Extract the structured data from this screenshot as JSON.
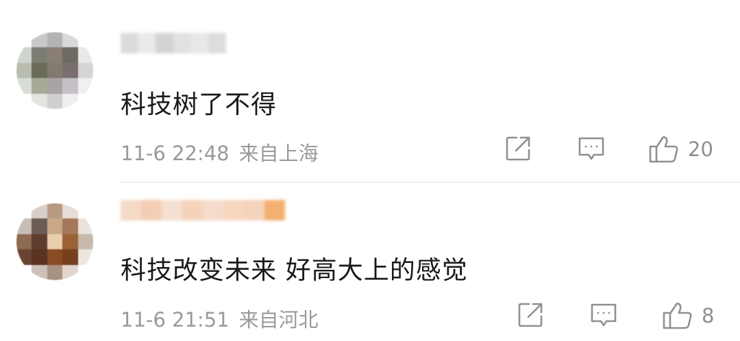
{
  "comments": [
    {
      "text": "科技树了不得",
      "time": "11-6 22:48",
      "location": "来自上海",
      "likes": "20",
      "avatar_colors": [
        "#ffffff",
        "#c9c9c9",
        "#b4b4b4",
        "#d9d9d9",
        "#ffffff",
        "#cfd4cf",
        "#7b7f73",
        "#8a7f74",
        "#6d6a63",
        "#e8e8e8",
        "#b9bdb0",
        "#6a6a5a",
        "#827a70",
        "#7a6f6e",
        "#d5d5d5",
        "#d8ded5",
        "#a6ab98",
        "#a8a4a6",
        "#c4c0c6",
        "#f0f0f0",
        "#ffffff",
        "#e2e5dd",
        "#cfcfcf",
        "#eeeeee",
        "#ffffff"
      ],
      "username_colors": [
        "#d8d8d8",
        "#e8e8e8",
        "#cfcfcf",
        "#dedede",
        "#e6e6e6",
        "#dadada"
      ]
    },
    {
      "text": "科技改变未来 好高大上的感觉",
      "time": "11-6 21:51",
      "location": "来自河北",
      "likes": "8",
      "avatar_colors": [
        "#ffffff",
        "#d8cfc9",
        "#b89a82",
        "#e6ddd6",
        "#ffffff",
        "#c7bdb6",
        "#6b5d55",
        "#c8a888",
        "#a6785a",
        "#e9e2dd",
        "#8d6a52",
        "#5e3d2c",
        "#e9cfae",
        "#9a6236",
        "#c8b9ad",
        "#6a4433",
        "#5a3321",
        "#8a4a24",
        "#74401e",
        "#ece6e1",
        "#ffffff",
        "#cdc0b8",
        "#a9927f",
        "#e1d6cd",
        "#ffffff"
      ],
      "username_colors": [
        "#f3d6c2",
        "#f2c9ad",
        "#f5dccb",
        "#f4cfb4",
        "#f5d8c6",
        "#f6d2b9",
        "#f4d0b5",
        "#f2a860"
      ]
    }
  ],
  "icons": {
    "repost": "repost-icon",
    "comment": "comment-icon",
    "like": "thumbs-up-icon"
  }
}
